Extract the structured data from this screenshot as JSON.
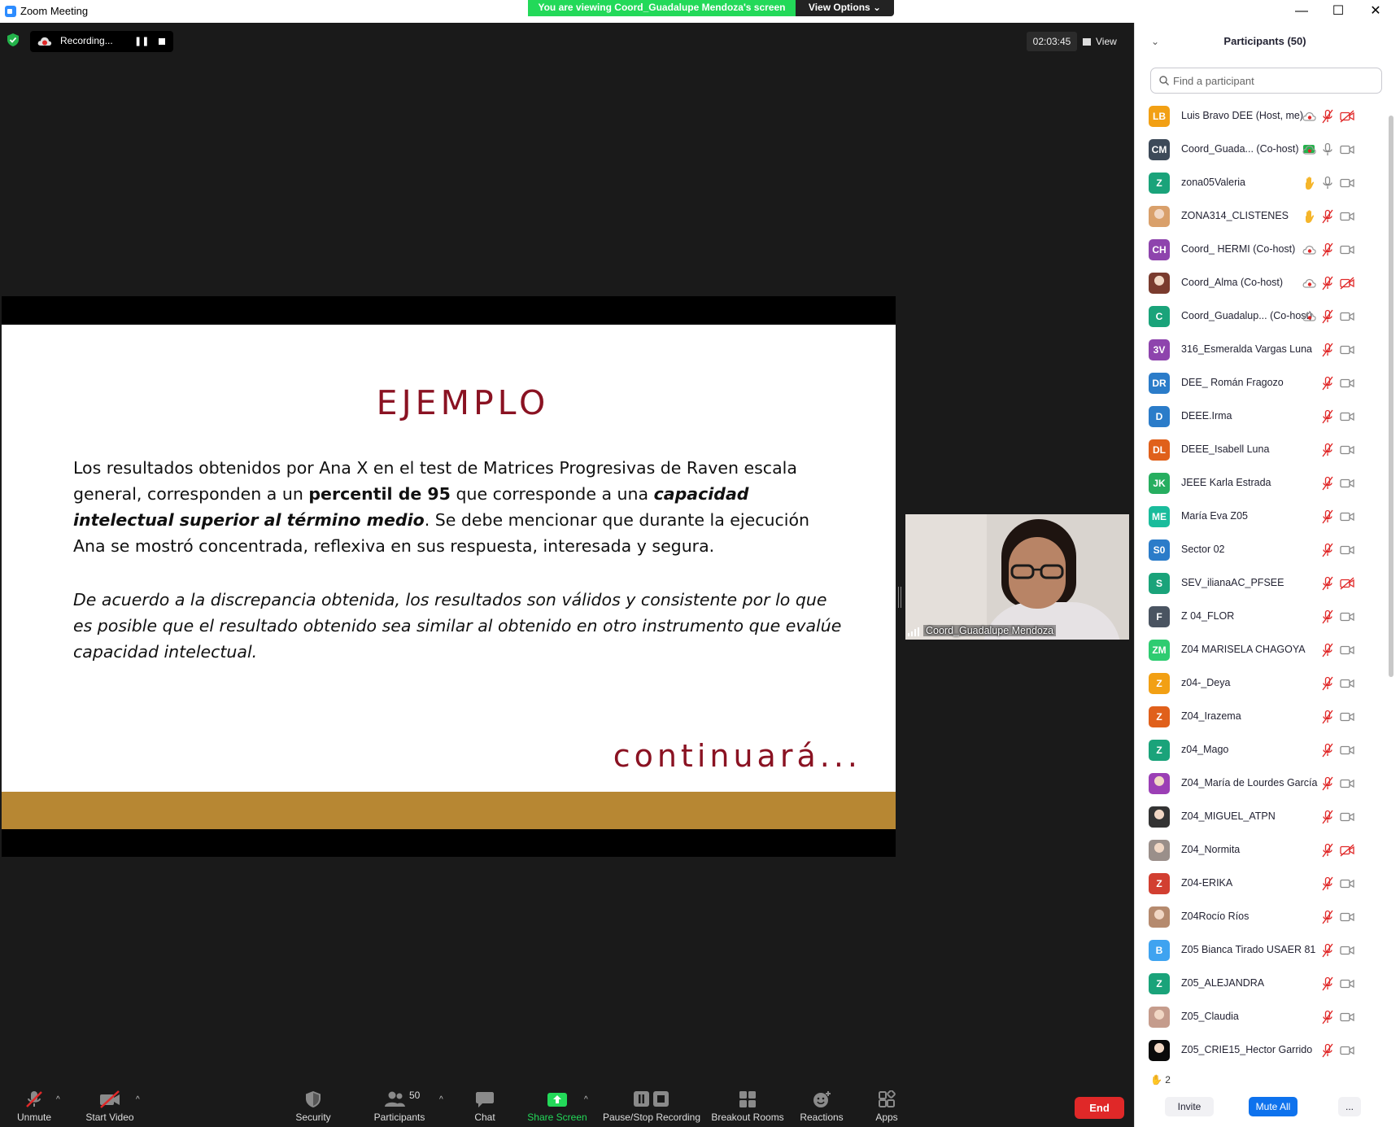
{
  "window": {
    "title": "Zoom Meeting",
    "viewing_banner": "You are viewing Coord_Guadalupe Mendoza's screen",
    "view_options": "View Options ⌄",
    "minimize": "—",
    "maximize": "☐",
    "close": "✕"
  },
  "meeting": {
    "recording_label": "Recording...",
    "pause_glyph": "❚❚",
    "timer": "02:03:45",
    "view_label": "View"
  },
  "slide": {
    "title": "EJEMPLO",
    "para1_a": "Los resultados obtenidos por  Ana  X en el test de Matrices Progresivas de Raven escala general, corresponden a un ",
    "para1_b": "percentil de 95",
    "para1_c": " que corresponde a una ",
    "para1_d": "capacidad intelectual superior al término medio",
    "para1_e": ". Se debe mencionar que durante la ejecución Ana se mostró concentrada, reflexiva en sus respuesta, interesada y segura.",
    "para2": "De acuerdo a la discrepancia obtenida, los resultados son válidos y consistente por lo que es posible que el resultado obtenido sea similar al  obtenido en otro instrumento que evalúe capacidad intelectual.",
    "closing": "continuará...",
    "band_color": "#b78733",
    "title_color": "#8a1222"
  },
  "video": {
    "name": "Coord_Guadalupe Mendoza"
  },
  "toolbar": {
    "unmute": "Unmute",
    "start_video": "Start Video",
    "security": "Security",
    "participants": "Participants",
    "participants_count": "50",
    "chat": "Chat",
    "share_screen": "Share Screen",
    "pause_stop_recording": "Pause/Stop Recording",
    "breakout_rooms": "Breakout Rooms",
    "reactions": "Reactions",
    "apps": "Apps",
    "caret": "^",
    "end": "End",
    "share_color": "#23d959"
  },
  "panel": {
    "collapse_glyph": "⌄",
    "title": "Participants (50)",
    "search_placeholder": "Find a participant",
    "participants": [
      {
        "initials": "LB",
        "name": "Luis Bravo DEE (Host, me)",
        "color": "#f2a014",
        "rec": true,
        "hand": false,
        "mic": "off",
        "cam": "off"
      },
      {
        "initials": "CM",
        "name": "Coord_Guada... (Co-host)",
        "color": "#3d4a59",
        "share": true,
        "rec": true,
        "hand": false,
        "mic": "on",
        "cam": "on"
      },
      {
        "initials": "Z",
        "name": "zona05Valeria",
        "color": "#1aa37a",
        "rec": false,
        "hand": true,
        "mic": "on",
        "cam": "on"
      },
      {
        "initials": "",
        "name": "ZONA314_CLISTENES",
        "color": "#d9a06b",
        "photo": true,
        "rec": false,
        "hand": true,
        "mic": "off",
        "cam": "on"
      },
      {
        "initials": "CH",
        "name": "Coord_ HERMI (Co-host)",
        "color": "#8e44ad",
        "rec": true,
        "hand": false,
        "mic": "off",
        "cam": "on"
      },
      {
        "initials": "",
        "name": "Coord_Alma (Co-host)",
        "color": "#7a3b2e",
        "photo": true,
        "rec": true,
        "hand": false,
        "mic": "off",
        "cam": "off"
      },
      {
        "initials": "C",
        "name": "Coord_Guadalup...  (Co-host)",
        "color": "#1aa37a",
        "rec": true,
        "hand": false,
        "mic": "off",
        "cam": "on"
      },
      {
        "initials": "3V",
        "name": "316_Esmeralda Vargas Luna",
        "color": "#8e44ad",
        "rec": false,
        "hand": false,
        "mic": "off",
        "cam": "on"
      },
      {
        "initials": "DR",
        "name": "DEE_ Román Fragozo",
        "color": "#2b7cc9",
        "rec": false,
        "hand": false,
        "mic": "off",
        "cam": "on"
      },
      {
        "initials": "D",
        "name": "DEEE.Irma",
        "color": "#2b7cc9",
        "rec": false,
        "hand": false,
        "mic": "off",
        "cam": "on"
      },
      {
        "initials": "DL",
        "name": "DEEE_Isabell Luna",
        "color": "#e0601b",
        "rec": false,
        "hand": false,
        "mic": "off",
        "cam": "on"
      },
      {
        "initials": "JK",
        "name": "JEEE Karla Estrada",
        "color": "#27ae60",
        "rec": false,
        "hand": false,
        "mic": "off",
        "cam": "on"
      },
      {
        "initials": "ME",
        "name": "María Eva Z05",
        "color": "#1abc9c",
        "rec": false,
        "hand": false,
        "mic": "off",
        "cam": "on"
      },
      {
        "initials": "S0",
        "name": "Sector 02",
        "color": "#2b7cc9",
        "rec": false,
        "hand": false,
        "mic": "off",
        "cam": "on"
      },
      {
        "initials": "S",
        "name": "SEV_ilianaAC_PFSEE",
        "color": "#1aa37a",
        "rec": false,
        "hand": false,
        "mic": "off",
        "cam": "off"
      },
      {
        "initials": "F",
        "name": "Z 04_FLOR",
        "color": "#4a5461",
        "rec": false,
        "hand": false,
        "mic": "off",
        "cam": "on"
      },
      {
        "initials": "ZM",
        "name": "Z04 MARISELA CHAGOYA",
        "color": "#2ecc71",
        "rec": false,
        "hand": false,
        "mic": "off",
        "cam": "on"
      },
      {
        "initials": "Z",
        "name": "z04-_Deya",
        "color": "#f2a014",
        "rec": false,
        "hand": false,
        "mic": "off",
        "cam": "on"
      },
      {
        "initials": "Z",
        "name": "Z04_Irazema",
        "color": "#e0601b",
        "rec": false,
        "hand": false,
        "mic": "off",
        "cam": "on"
      },
      {
        "initials": "Z",
        "name": "z04_Mago",
        "color": "#1aa37a",
        "rec": false,
        "hand": false,
        "mic": "off",
        "cam": "on"
      },
      {
        "initials": "",
        "name": "Z04_María de Lourdes García",
        "color": "#9b3fb5",
        "photo": true,
        "rec": false,
        "hand": false,
        "mic": "off",
        "cam": "on"
      },
      {
        "initials": "",
        "name": "Z04_MIGUEL_ATPN",
        "color": "#333333",
        "photo": true,
        "rec": false,
        "hand": false,
        "mic": "off",
        "cam": "on"
      },
      {
        "initials": "",
        "name": "Z04_Normita",
        "color": "#9a8f8a",
        "photo": true,
        "rec": false,
        "hand": false,
        "mic": "off",
        "cam": "off"
      },
      {
        "initials": "Z",
        "name": "Z04-ERIKA",
        "color": "#d23f31",
        "rec": false,
        "hand": false,
        "mic": "off",
        "cam": "on"
      },
      {
        "initials": "",
        "name": "Z04Rocío Ríos",
        "color": "#b58a6e",
        "photo": true,
        "rec": false,
        "hand": false,
        "mic": "off",
        "cam": "on"
      },
      {
        "initials": "B",
        "name": "Z05 Bianca Tirado USAER 81",
        "color": "#3fa3f0",
        "rec": false,
        "hand": false,
        "mic": "off",
        "cam": "on"
      },
      {
        "initials": "Z",
        "name": "Z05_ALEJANDRA",
        "color": "#1aa37a",
        "rec": false,
        "hand": false,
        "mic": "off",
        "cam": "on"
      },
      {
        "initials": "",
        "name": "Z05_Claudia",
        "color": "#c59c8c",
        "photo": true,
        "rec": false,
        "hand": false,
        "mic": "off",
        "cam": "on"
      },
      {
        "initials": "",
        "name": "Z05_CRIE15_Hector Garrido",
        "color": "#0a0a0a",
        "photo": true,
        "rec": false,
        "hand": false,
        "mic": "off",
        "cam": "on"
      }
    ],
    "raised_hands": "2",
    "hand_glyph": "✋",
    "invite": "Invite",
    "mute_all": "Mute All",
    "more": "..."
  }
}
